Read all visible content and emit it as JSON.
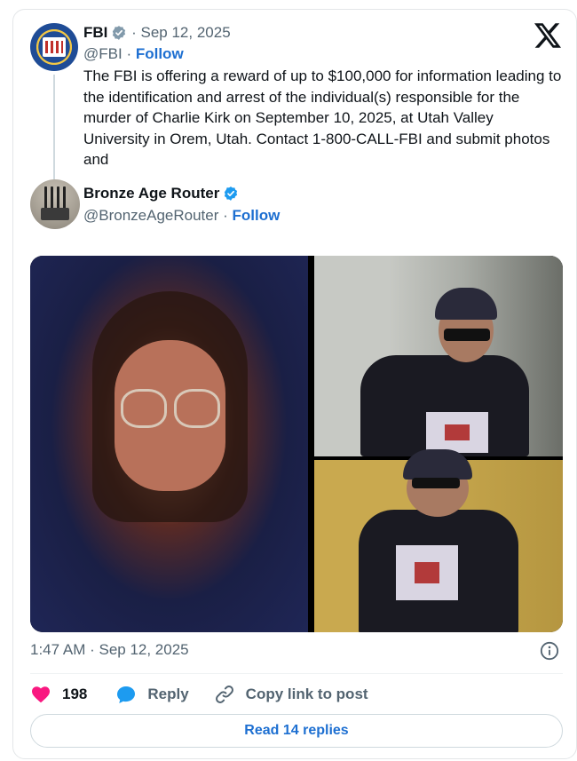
{
  "quoted_tweet": {
    "author_name": "FBI",
    "date": "Sep 12, 2025",
    "handle": "@FBI",
    "follow_label": "Follow",
    "text": "The FBI is offering a reward of up to $100,000 for information leading to the identification and arrest of the individual(s) responsible for the murder of Charlie Kirk on September 10, 2025, at Utah Valley University in Orem, Utah. Contact 1-800-CALL-FBI and submit photos and"
  },
  "tweet": {
    "author_name": "Bronze Age Router",
    "handle": "@BronzeAgeRouter",
    "follow_label": "Follow",
    "media_caption": "",
    "timestamp": "1:47 AM · Sep 12, 2025"
  },
  "actions": {
    "likes": "198",
    "reply_label": "Reply",
    "copy_link_label": "Copy link to post"
  },
  "read_replies_label": "Read 14 replies",
  "icons": [
    "x-logo-icon",
    "verified-badge-icon",
    "info-icon",
    "heart-icon",
    "reply-bubble-icon",
    "link-icon"
  ],
  "colors": {
    "link_blue": "#1d6fd1",
    "verified_blue": "#1d9bf0",
    "like_pink": "#f91880",
    "muted_text": "#536471"
  }
}
